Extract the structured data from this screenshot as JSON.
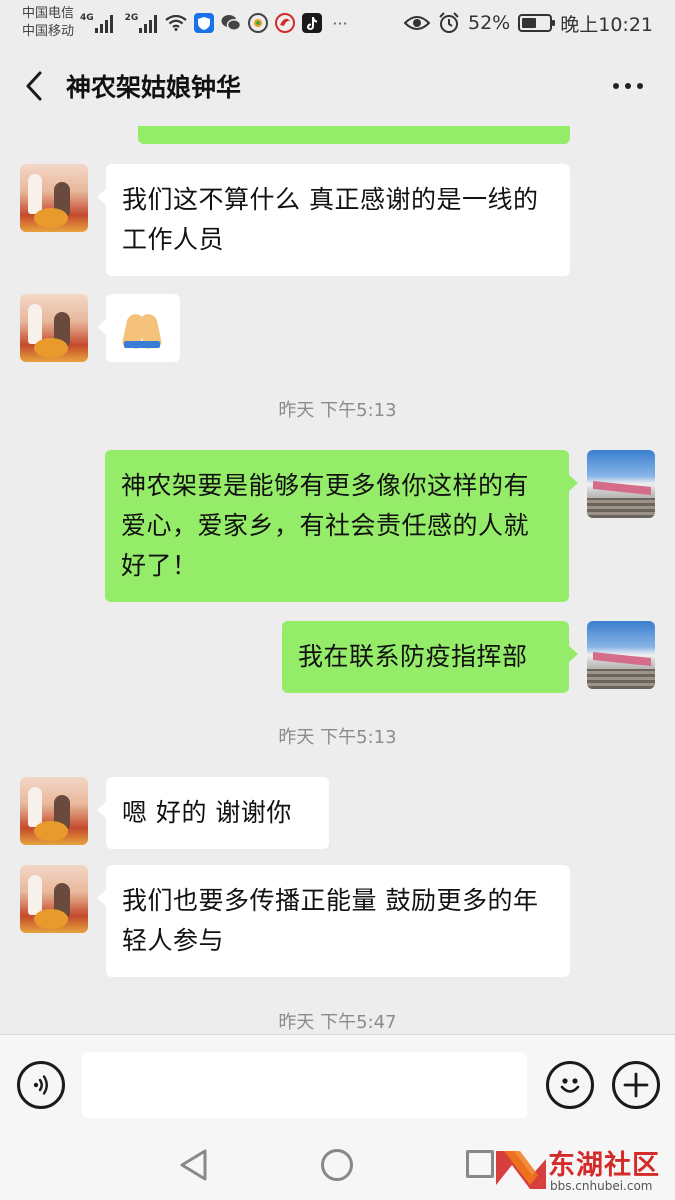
{
  "status_bar": {
    "carrier_1": "中国电信",
    "carrier_2": "中国移动",
    "network_1": "4G",
    "network_2": "2G",
    "battery_text": "52%",
    "battery_level": 0.52,
    "time": "晚上10:21",
    "app_icons": [
      "shield-app-icon",
      "wechat-icon",
      "gallery-app-icon",
      "phoenix-news-icon",
      "tiktok-icon"
    ]
  },
  "header": {
    "title": "神农架姑娘钟华"
  },
  "messages": [
    {
      "sender": "other",
      "text": "我们这不算什么  真正感谢的是一线的工作人员"
    },
    {
      "sender": "other",
      "emoji": "folded-hands-emoji"
    },
    {
      "timestamp": "昨天 下午5:13"
    },
    {
      "sender": "self",
      "text": "神农架要是能够有更多像你这样的有爱心，爱家乡，有社会责任感的人就好了！"
    },
    {
      "sender": "self",
      "text": "我在联系防疫指挥部"
    },
    {
      "timestamp": "昨天 下午5:13"
    },
    {
      "sender": "other",
      "text": "嗯 好的 谢谢你"
    },
    {
      "sender": "other",
      "text": "我们也要多传播正能量 鼓励更多的年轻人参与"
    },
    {
      "timestamp": "昨天 下午5:47"
    }
  ],
  "input_bar": {
    "value": "",
    "placeholder": ""
  },
  "watermark": {
    "brand": "东湖社区",
    "url": "bbs.cnhubei.com"
  },
  "colors": {
    "self_bubble": "#95ec69",
    "other_bubble": "#ffffff",
    "background": "#ededed",
    "watermark": "#d42a2a"
  }
}
